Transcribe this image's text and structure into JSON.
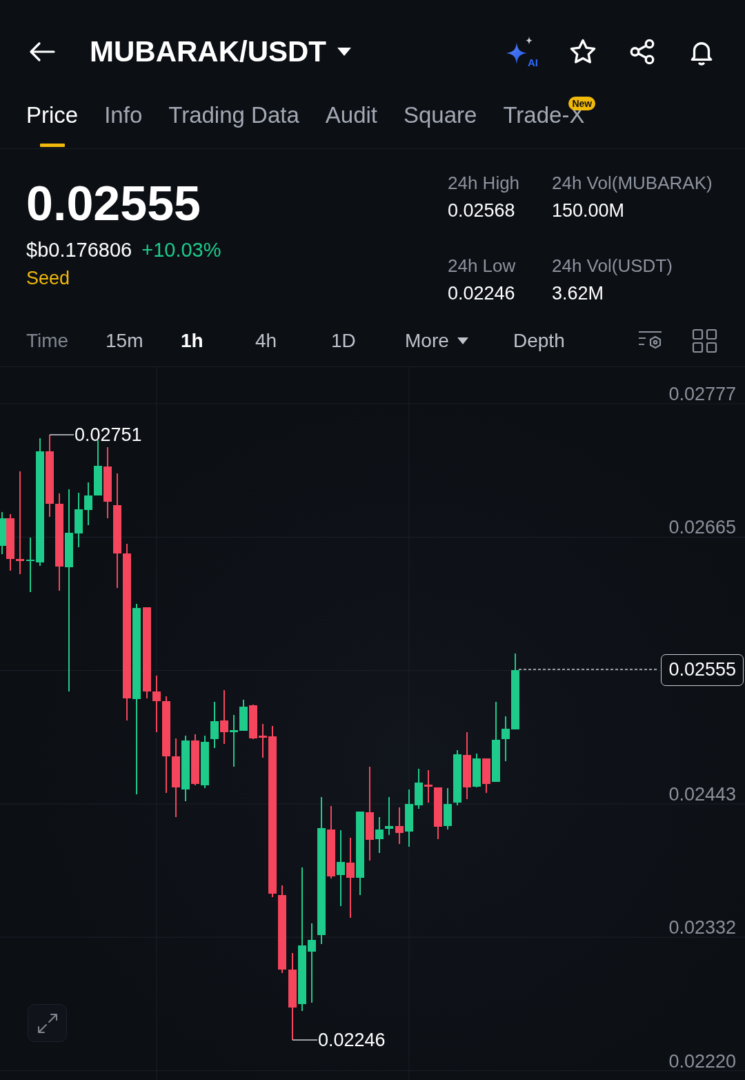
{
  "header": {
    "title": "MUBARAK/USDT",
    "ai_label": "AI"
  },
  "tabs": [
    {
      "label": "Price",
      "selected": true
    },
    {
      "label": "Info",
      "selected": false
    },
    {
      "label": "Trading Data",
      "selected": false
    },
    {
      "label": "Audit",
      "selected": false
    },
    {
      "label": "Square",
      "selected": false
    },
    {
      "label": "Trade-X",
      "selected": false,
      "badge": "New"
    }
  ],
  "price": {
    "last": "0.02555",
    "fiat": "$b0.176806",
    "change": "+10.03%",
    "rising": true,
    "tag": "Seed"
  },
  "stats": [
    {
      "label": "24h High",
      "value": "0.02568"
    },
    {
      "label": "24h Vol(MUBARAK)",
      "value": "150.00M"
    },
    {
      "label": "24h Low",
      "value": "0.02246"
    },
    {
      "label": "24h Vol(USDT)",
      "value": "3.62M"
    }
  ],
  "timeframes": [
    {
      "label": "Time",
      "kind": "label",
      "selected": false
    },
    {
      "label": "15m",
      "kind": "interval",
      "selected": false
    },
    {
      "label": "1h",
      "kind": "interval",
      "selected": true
    },
    {
      "label": "4h",
      "kind": "interval",
      "selected": false
    },
    {
      "label": "1D",
      "kind": "interval",
      "selected": false
    },
    {
      "label": "More",
      "kind": "menu",
      "selected": false
    },
    {
      "label": "Depth",
      "kind": "mode",
      "selected": false
    }
  ],
  "chart": {
    "high_marker": "0.02751",
    "low_marker": "0.02246",
    "axis": [
      {
        "label": "0.02777",
        "kind": "tick"
      },
      {
        "label": "0.02665",
        "kind": "tick"
      },
      {
        "label": "0.02555",
        "kind": "current"
      },
      {
        "label": "0.02443",
        "kind": "tick"
      },
      {
        "label": "0.02332",
        "kind": "tick"
      },
      {
        "label": "0.02220",
        "kind": "tick"
      }
    ]
  }
}
